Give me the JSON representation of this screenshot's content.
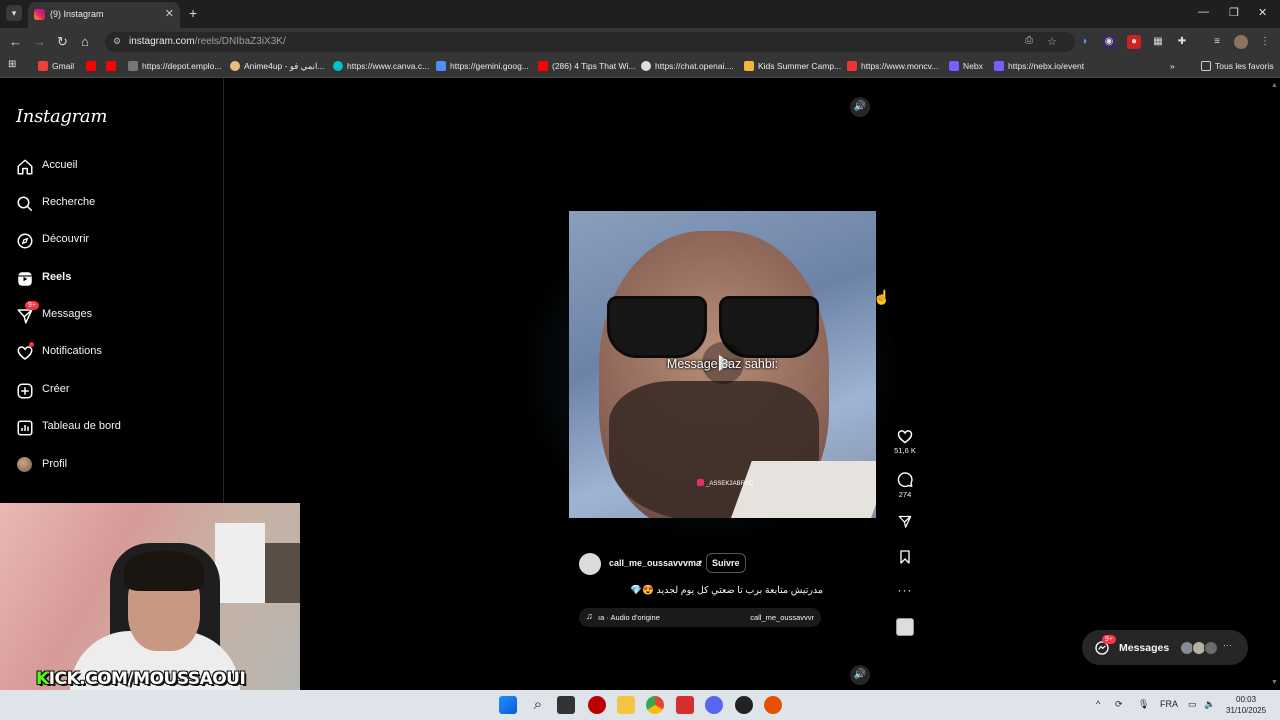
{
  "browser": {
    "tab_title": "(9) Instagram",
    "url_host": "instagram.com",
    "url_path": "/reels/DNIbaZ3iX3K/",
    "bookmarks": [
      "Gmail",
      "https://depot.emplo...",
      "Anime4up - انمي فو...",
      "https://www.canva.c...",
      "https://gemini.goog...",
      "(286) 4 Tips That Wi...",
      "https://chat.openai....",
      "Kids Summer Camp...",
      "https://www.moncv...",
      "Nebx",
      "https://nebx.io/event"
    ],
    "all_bookmarks": "Tous les favoris"
  },
  "instagram": {
    "logo": "Instagram",
    "nav": [
      {
        "label": "Accueil",
        "icon": "home-icon"
      },
      {
        "label": "Recherche",
        "icon": "search-icon"
      },
      {
        "label": "Découvrir",
        "icon": "compass-icon"
      },
      {
        "label": "Reels",
        "icon": "reels-icon"
      },
      {
        "label": "Messages",
        "icon": "send-icon",
        "badge": "9+"
      },
      {
        "label": "Notifications",
        "icon": "heart-icon"
      },
      {
        "label": "Créer",
        "icon": "plus-square-icon"
      },
      {
        "label": "Tableau de bord",
        "icon": "bar-chart-icon"
      },
      {
        "label": "Profil",
        "icon": "avatar-icon"
      }
    ]
  },
  "webcam": {
    "overlay_prefix": "K",
    "overlay_text": "KICK.COM/MOUSSAOUI"
  },
  "reel": {
    "caption_overlay": "Message 3az sahbi:",
    "video_tag": "_ASSEK2ABRAD",
    "likes": "51,6 K",
    "comments": "274",
    "username": "call_me_oussavvvma",
    "separator": "•",
    "follow_label": "Suivre",
    "description": "مدرتيش متابعة برب تا ضعتي كل يوم لجديد 😍💎",
    "audio_prefix": "ıa · Audio d'origine",
    "audio_user": "call_me_oussavvvr"
  },
  "messages_pill": {
    "label": "Messages",
    "badge": "9+"
  },
  "taskbar": {
    "lang": "FRA",
    "time": "00:03",
    "date": "31/10/2025"
  }
}
